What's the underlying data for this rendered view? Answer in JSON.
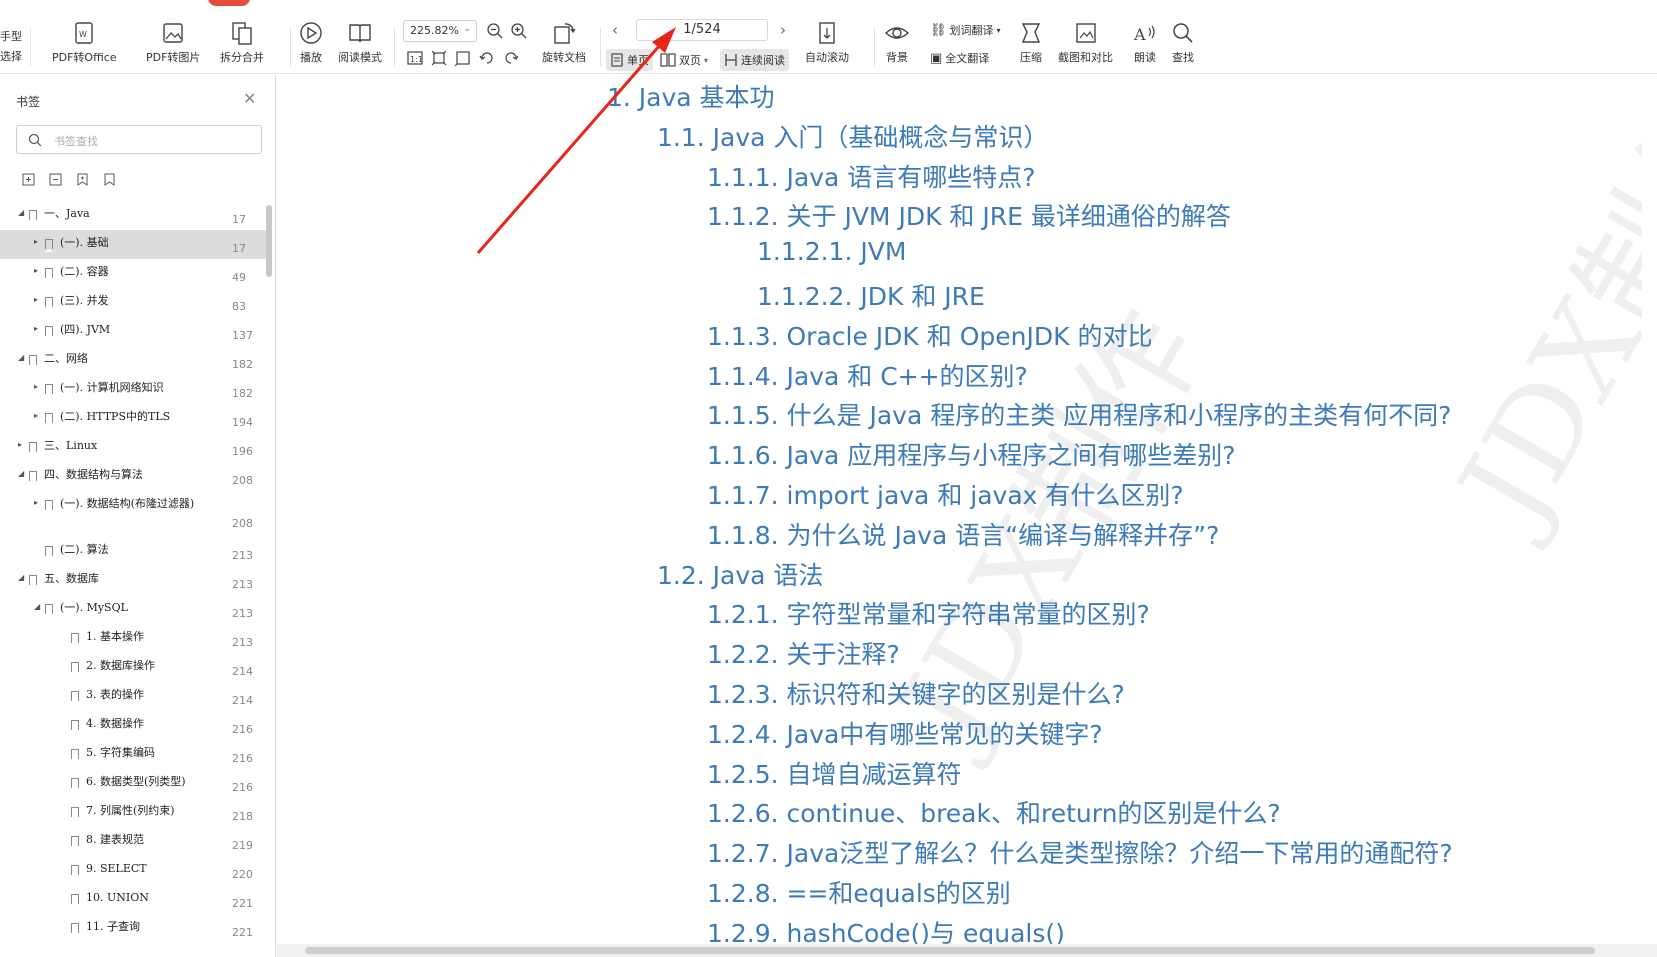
{
  "toolbar": {
    "hand_line1": "手型",
    "hand_line2": "选择",
    "pdf_to_office": "PDF转Office",
    "pdf_to_image": "PDF转图片",
    "split_merge": "拆分合并",
    "play": "播放",
    "read_mode": "阅读模式",
    "zoom": "225.82%",
    "rotate_doc": "旋转文档",
    "page_indicator": "1/524",
    "single_page": "单页",
    "double_page": "双页",
    "continuous": "连续阅读",
    "auto_scroll": "自动滚动",
    "background": "背景",
    "word_translate": "划词翻译",
    "full_translate": "全文翻译",
    "compress": "压缩",
    "screenshot_compare": "截图和对比",
    "read_aloud": "朗读",
    "find": "查找"
  },
  "sidebar": {
    "title": "书签",
    "search_placeholder": "书签查找",
    "items": [
      {
        "level": 0,
        "twisty": "expanded",
        "label": "一、Java",
        "page": "17"
      },
      {
        "level": 1,
        "twisty": "collapsed",
        "label": "(一). 基础",
        "page": "17",
        "selected": true
      },
      {
        "level": 1,
        "twisty": "collapsed",
        "label": "(二). 容器",
        "page": "49"
      },
      {
        "level": 1,
        "twisty": "collapsed",
        "label": "(三). 并发",
        "page": "83"
      },
      {
        "level": 1,
        "twisty": "collapsed",
        "label": "(四). JVM",
        "page": "137"
      },
      {
        "level": 0,
        "twisty": "expanded",
        "label": "二、网络",
        "page": "182"
      },
      {
        "level": 1,
        "twisty": "collapsed",
        "label": "(一). 计算机网络知识",
        "page": "182"
      },
      {
        "level": 1,
        "twisty": "collapsed",
        "label": "(二). HTTPS中的TLS",
        "page": "194"
      },
      {
        "level": 0,
        "twisty": "collapsed",
        "label": "三、Linux",
        "page": "196"
      },
      {
        "level": 0,
        "twisty": "expanded",
        "label": "四、数据结构与算法",
        "page": "208"
      },
      {
        "level": 1,
        "twisty": "collapsed",
        "label": "(一). 数据结构(布隆过滤器)",
        "page": "208",
        "tall": true
      },
      {
        "level": 1,
        "twisty": "none",
        "label": "(二). 算法",
        "page": "213"
      },
      {
        "level": 0,
        "twisty": "expanded",
        "label": "五、数据库",
        "page": "213"
      },
      {
        "level": 1,
        "twisty": "expanded",
        "label": "(一). MySQL",
        "page": "213"
      },
      {
        "level": 2,
        "twisty": "none",
        "label": "1. 基本操作",
        "page": "213"
      },
      {
        "level": 2,
        "twisty": "none",
        "label": "2. 数据库操作",
        "page": "214"
      },
      {
        "level": 2,
        "twisty": "none",
        "label": "3. 表的操作",
        "page": "214"
      },
      {
        "level": 2,
        "twisty": "none",
        "label": "4. 数据操作",
        "page": "216"
      },
      {
        "level": 2,
        "twisty": "none",
        "label": "5. 字符集编码",
        "page": "216"
      },
      {
        "level": 2,
        "twisty": "none",
        "label": "6. 数据类型(列类型)",
        "page": "216"
      },
      {
        "level": 2,
        "twisty": "none",
        "label": "7. 列属性(列约束)",
        "page": "218"
      },
      {
        "level": 2,
        "twisty": "none",
        "label": "8. 建表规范",
        "page": "219"
      },
      {
        "level": 2,
        "twisty": "none",
        "label": "9. SELECT",
        "page": "220"
      },
      {
        "level": 2,
        "twisty": "none",
        "label": "10. UNION",
        "page": "221"
      },
      {
        "level": 2,
        "twisty": "none",
        "label": "11. 子查询",
        "page": "221"
      }
    ]
  },
  "content": {
    "watermark": "JDX制作",
    "toc": [
      {
        "level": 0,
        "text": "1. Java 基本功"
      },
      {
        "level": 1,
        "text": "1.1. Java 入门（基础概念与常识）"
      },
      {
        "level": 2,
        "text": "1.1.1. Java 语言有哪些特点?"
      },
      {
        "level": 2,
        "text": "1.1.2. 关于 JVM JDK 和 JRE 最详细通俗的解答"
      },
      {
        "level": 3,
        "text": "1.1.2.1. JVM"
      },
      {
        "level": 3,
        "text": "1.1.2.2. JDK 和 JRE"
      },
      {
        "level": 2,
        "text": "1.1.3. Oracle JDK 和 OpenJDK 的对比"
      },
      {
        "level": 2,
        "text": "1.1.4. Java 和 C++的区别?"
      },
      {
        "level": 2,
        "text": "1.1.5. 什么是 Java 程序的主类 应用程序和小程序的主类有何不同?"
      },
      {
        "level": 2,
        "text": "1.1.6. Java 应用程序与小程序之间有哪些差别?"
      },
      {
        "level": 2,
        "text": "1.1.7. import java 和 javax 有什么区别?"
      },
      {
        "level": 2,
        "text": "1.1.8. 为什么说 Java 语言“编译与解释并存”?"
      },
      {
        "level": 1,
        "text": "1.2. Java 语法"
      },
      {
        "level": 2,
        "text": "1.2.1. 字符型常量和字符串常量的区别?"
      },
      {
        "level": 2,
        "text": "1.2.2. 关于注释?"
      },
      {
        "level": 2,
        "text": "1.2.3. 标识符和关键字的区别是什么?"
      },
      {
        "level": 2,
        "text": "1.2.4. Java中有哪些常见的关键字?"
      },
      {
        "level": 2,
        "text": "1.2.5. 自增自减运算符"
      },
      {
        "level": 2,
        "text": "1.2.6. continue、break、和return的区别是什么?"
      },
      {
        "level": 2,
        "text": "1.2.7. Java泛型了解么？什么是类型擦除？介绍一下常用的通配符?"
      },
      {
        "level": 2,
        "text": "1.2.8. ==和equals的区别"
      },
      {
        "level": 2,
        "text": "1.2.9. hashCode()与 equals()"
      }
    ]
  },
  "colors": {
    "toc_text": "#3d7ab8",
    "arrow": "#e8241c",
    "selected_row": "#dcdcdc"
  }
}
